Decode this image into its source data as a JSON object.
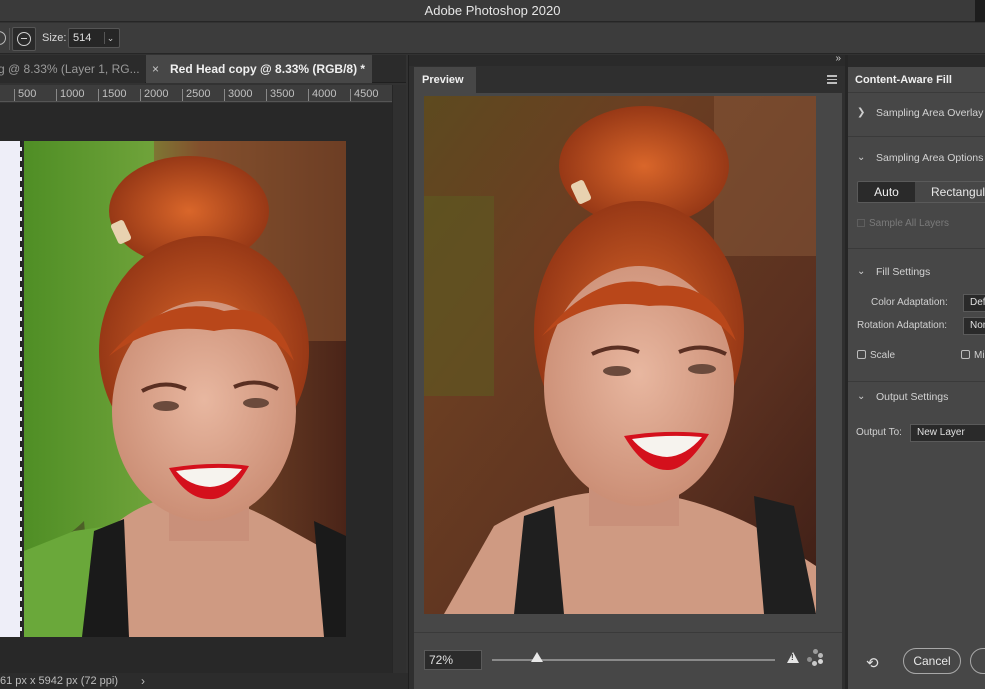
{
  "app": {
    "title": "Adobe Photoshop 2020"
  },
  "options_bar": {
    "size_label": "Size:",
    "size_value": "514"
  },
  "doc_tabs": [
    {
      "label": "g @ 8.33% (Layer 1, RG..."
    },
    {
      "label": "Red Head copy @ 8.33% (RGB/8) *",
      "close": "×"
    }
  ],
  "ruler": {
    "labels": [
      "500",
      "1000",
      "1500",
      "2000",
      "2500",
      "3000",
      "3500",
      "4000",
      "4500"
    ]
  },
  "status": {
    "dimensions": "61 px x 5942 px (72 ppi)",
    "chevron": "›"
  },
  "preview": {
    "tab_label": "Preview",
    "zoom": "72%",
    "zoom_fraction": 0.16
  },
  "content_aware_fill": {
    "title": "Content-Aware Fill",
    "sections": {
      "sampling_overlay": "Sampling Area Overlay",
      "sampling_options": "Sampling Area Options",
      "fill_settings": "Fill Settings",
      "output_settings": "Output Settings"
    },
    "sampling_modes": {
      "auto": "Auto",
      "rectangular": "Rectangular"
    },
    "sample_all_layers": "Sample All Layers",
    "color_adaptation": {
      "label": "Color Adaptation:",
      "value": "Default"
    },
    "rotation_adaptation": {
      "label": "Rotation Adaptation:",
      "value": "None"
    },
    "scale_label": "Scale",
    "mirror_label": "Mirror",
    "output_to": {
      "label": "Output To:",
      "value": "New Layer"
    },
    "cancel_label": "Cancel"
  },
  "colors": {
    "panel_bg": "#474747",
    "app_bg": "#323232",
    "lipstick": "#d4101c",
    "hair": "#c2521c",
    "background_green": "#5e9b2c"
  }
}
